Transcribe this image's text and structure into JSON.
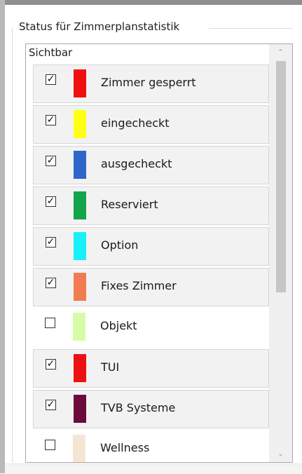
{
  "group": {
    "title": "Status für Zimmerplanstatistik"
  },
  "list": {
    "header": "Sichtbar",
    "items": [
      {
        "label": "Zimmer gesperrt",
        "checked": true,
        "color": "#f01010",
        "selected": true
      },
      {
        "label": "eingecheckt",
        "checked": true,
        "color": "#ffff14",
        "selected": true
      },
      {
        "label": "ausgecheckt",
        "checked": true,
        "color": "#2f66c9",
        "selected": true
      },
      {
        "label": "Reserviert",
        "checked": true,
        "color": "#12a54c",
        "selected": true
      },
      {
        "label": "Option",
        "checked": true,
        "color": "#18f1f9",
        "selected": true
      },
      {
        "label": "Fixes Zimmer",
        "checked": true,
        "color": "#f27c52",
        "selected": true
      },
      {
        "label": "Objekt",
        "checked": false,
        "color": "#d6fca8",
        "selected": false
      },
      {
        "label": "TUI",
        "checked": true,
        "color": "#ee1111",
        "selected": true
      },
      {
        "label": "TVB Systeme",
        "checked": true,
        "color": "#6b0a3c",
        "selected": true
      },
      {
        "label": "Wellness",
        "checked": false,
        "color": "#f7e5d4",
        "selected": false
      }
    ]
  },
  "icons": {
    "scroll_up": "chevron-up-icon",
    "scroll_down": "chevron-down-icon",
    "check": "check-icon"
  }
}
